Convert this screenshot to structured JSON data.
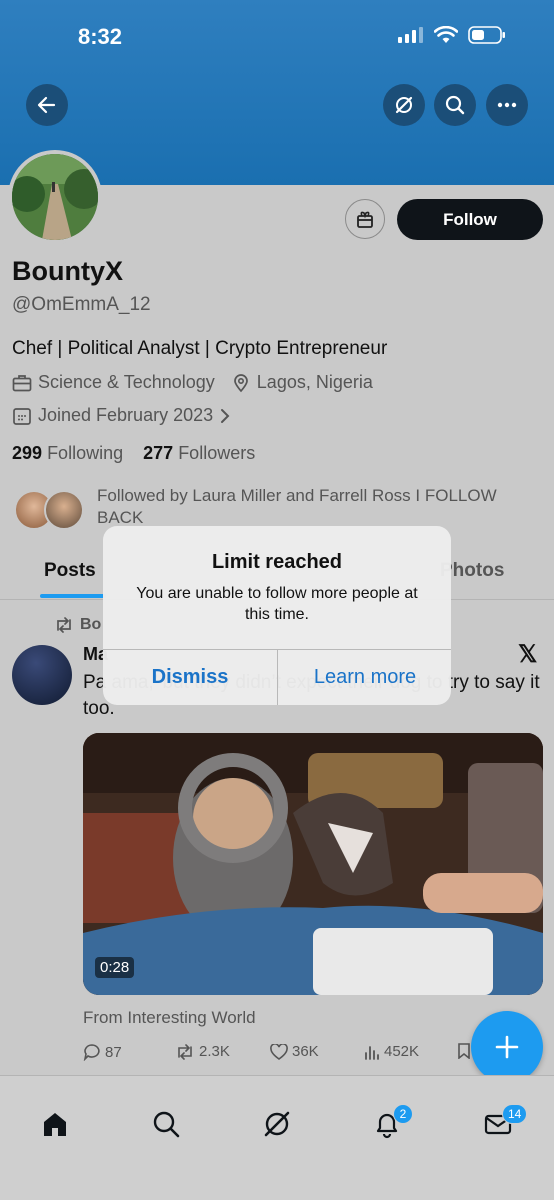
{
  "status_bar": {
    "time": "8:32"
  },
  "profile": {
    "name": "BountyX",
    "handle": "@OmEmmA_12",
    "bio": "Chef | Political Analyst | Crypto Entrepreneur",
    "category": "Science & Technology",
    "location": "Lagos, Nigeria",
    "joined": "Joined February 2023",
    "following_count": "299",
    "following_label": "Following",
    "followers_count": "277",
    "followers_label": "Followers",
    "followed_by": "Followed by Laura Miller and Farrell Ross I FOLLOW BACK",
    "follow_label": "Follow"
  },
  "tabs": [
    {
      "label": "Posts",
      "active": true
    },
    {
      "label": "Photos",
      "active": false
    }
  ],
  "post": {
    "repost_label": "Bo",
    "author": "Ma",
    "text": "Pa                                          ama,’ but they didn’t expect their dog to try to say it too.",
    "video_duration": "0:28",
    "from_label": "From Interesting World",
    "replies": "87",
    "reposts": "2.3K",
    "likes": "36K",
    "views": "452K"
  },
  "bottom_nav": {
    "notifications_badge": "2",
    "messages_badge": "14"
  },
  "alert": {
    "title": "Limit reached",
    "message": "You are unable to follow more people at this time.",
    "dismiss_label": "Dismiss",
    "learn_more_label": "Learn more"
  },
  "colors": {
    "accent": "#1d9bf0",
    "banner": "#1a6fb0",
    "follow_button": "#0f1419",
    "alert_button_text": "#1a73c8"
  }
}
